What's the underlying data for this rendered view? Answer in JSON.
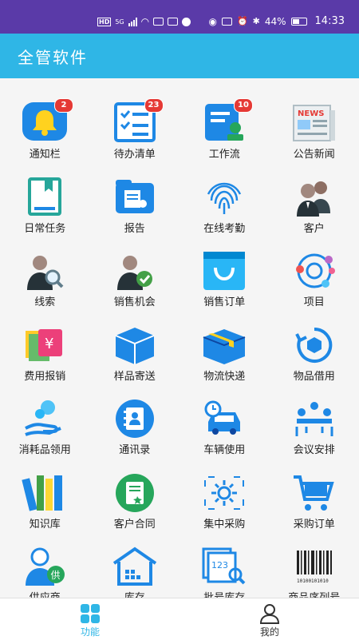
{
  "status_bar": {
    "hd_label": "HD",
    "net_label": "5G",
    "battery": "44%",
    "time": "14:33"
  },
  "app_bar": {
    "title": "全管软件"
  },
  "colors": {
    "status_bar": "#5a3aa8",
    "accent": "#2fb6e6",
    "badge": "#e53935",
    "icon_blue": "#1e88e5",
    "icon_green": "#26a65b"
  },
  "grid": {
    "items": [
      {
        "label": "通知栏",
        "icon": "bell-icon",
        "badge": "2"
      },
      {
        "label": "待办清单",
        "icon": "checklist-icon",
        "badge": "23"
      },
      {
        "label": "工作流",
        "icon": "workflow-stamp-icon",
        "badge": "10"
      },
      {
        "label": "公告新闻",
        "icon": "newspaper-icon"
      },
      {
        "label": "日常任务",
        "icon": "bookmark-document-icon"
      },
      {
        "label": "报告",
        "icon": "report-folder-icon"
      },
      {
        "label": "在线考勤",
        "icon": "fingerprint-icon"
      },
      {
        "label": "客户",
        "icon": "customers-icon"
      },
      {
        "label": "线索",
        "icon": "lead-search-icon"
      },
      {
        "label": "销售机会",
        "icon": "sales-opportunity-icon"
      },
      {
        "label": "销售订单",
        "icon": "shopping-bag-icon"
      },
      {
        "label": "项目",
        "icon": "project-network-icon"
      },
      {
        "label": "费用报销",
        "icon": "expense-yen-icon"
      },
      {
        "label": "样品寄送",
        "icon": "sample-box-icon"
      },
      {
        "label": "物流快递",
        "icon": "logistics-box-icon"
      },
      {
        "label": "物品借用",
        "icon": "item-loan-icon"
      },
      {
        "label": "消耗品领用",
        "icon": "consumables-hand-icon"
      },
      {
        "label": "通讯录",
        "icon": "address-book-icon"
      },
      {
        "label": "车辆使用",
        "icon": "car-clock-icon"
      },
      {
        "label": "会议安排",
        "icon": "meeting-icon"
      },
      {
        "label": "知识库",
        "icon": "books-icon"
      },
      {
        "label": "客户合同",
        "icon": "contract-icon"
      },
      {
        "label": "集中采购",
        "icon": "central-purchase-gear-icon"
      },
      {
        "label": "采购订单",
        "icon": "shopping-cart-icon"
      },
      {
        "label": "供应商",
        "icon": "supplier-icon",
        "tag": "供"
      },
      {
        "label": "库存",
        "icon": "warehouse-icon"
      },
      {
        "label": "批号库存",
        "icon": "batch-number-icon",
        "tag": "123"
      },
      {
        "label": "商品序列号",
        "icon": "barcode-icon",
        "tag": "10100101010"
      }
    ]
  },
  "bottom_nav": {
    "items": [
      {
        "label": "功能",
        "icon": "grid-icon",
        "active": true
      },
      {
        "label": "我的",
        "icon": "person-icon",
        "active": false
      }
    ]
  }
}
